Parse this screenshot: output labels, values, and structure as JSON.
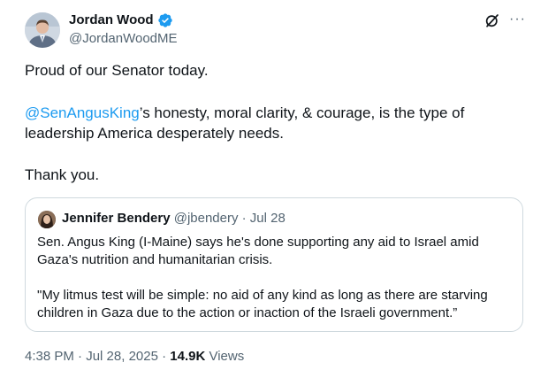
{
  "tweet": {
    "author": {
      "name": "Jordan Wood",
      "handle": "@JordanWoodME"
    },
    "text": {
      "line1": "Proud of our Senator today.",
      "mention": "@SenAngusKing",
      "line2_rest": "’s honesty, moral clarity, & courage, is the type of leadership America desperately needs.",
      "line3": "Thank you."
    },
    "footer": {
      "time": "4:38 PM",
      "dot": " · ",
      "date": "Jul 28, 2025",
      "views_count": "14.9K",
      "views_label": " Views"
    }
  },
  "quote": {
    "author": {
      "name": "Jennifer Bendery",
      "handle_time": " @jbendery · Jul 28"
    },
    "para1": "Sen. Angus King (I-Maine) says he's done supporting any aid to Israel amid Gaza's nutrition and humanitarian crisis.",
    "para2": "\"My litmus test will be simple: no aid of any kind as long as there are starving children in Gaza due to the action or inaction of the Israeli government.”"
  },
  "icons": {
    "verified": "verified-badge-icon",
    "grok": "grok-icon",
    "more": "more-icon"
  },
  "colors": {
    "accent": "#1d9bf0",
    "text": "#0f1419",
    "muted": "#536471",
    "border": "#cfd9de"
  }
}
